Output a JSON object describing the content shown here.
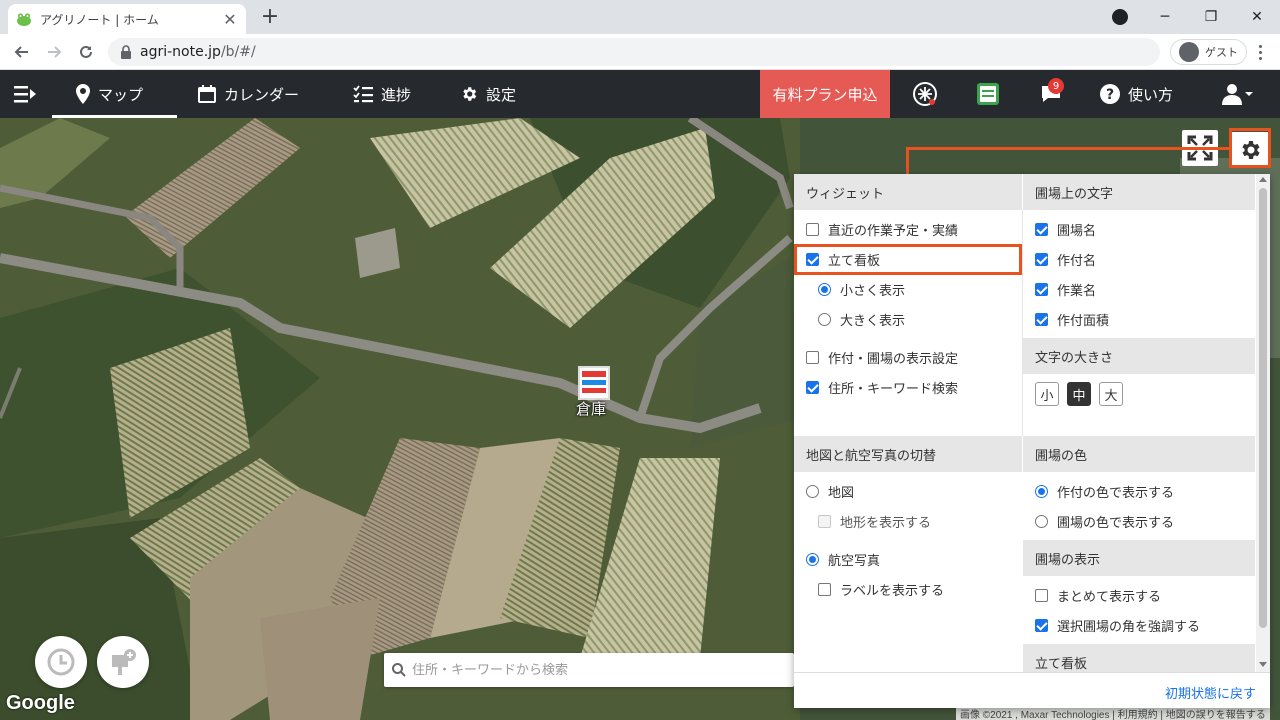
{
  "browser": {
    "tab_title": "アグリノート | ホーム",
    "url_host": "agri-note.jp",
    "url_path": "/b/#/",
    "profile_label": "ゲスト"
  },
  "navbar": {
    "map": "マップ",
    "calendar": "カレンダー",
    "progress": "進捗",
    "settings": "設定",
    "premium": "有料プラン申込",
    "notification_count": "9",
    "help": "使い方"
  },
  "map": {
    "warehouse_label": "倉庫",
    "search_placeholder": "住所・キーワードから検索",
    "google": "Google",
    "attribution": "画像 ©2021 , Maxar Technologies | 利用規約 | 地図の誤りを報告する"
  },
  "panel": {
    "widget": {
      "title": "ウィジェット",
      "items": [
        {
          "label": "直近の作業予定・実績",
          "checked": false
        },
        {
          "label": "立て看板",
          "checked": true
        },
        {
          "label": "小さく表示",
          "selected": true
        },
        {
          "label": "大きく表示",
          "selected": false
        },
        {
          "label": "作付・圃場の表示設定",
          "checked": false
        },
        {
          "label": "住所・キーワード検索",
          "checked": true
        }
      ]
    },
    "field_text": {
      "title": "圃場上の文字",
      "items": [
        {
          "label": "圃場名",
          "checked": true
        },
        {
          "label": "作付名",
          "checked": true
        },
        {
          "label": "作業名",
          "checked": true
        },
        {
          "label": "作付面積",
          "checked": true
        }
      ]
    },
    "text_size": {
      "title": "文字の大きさ",
      "options": [
        "小",
        "中",
        "大"
      ],
      "selected": "中"
    },
    "map_switch": {
      "title": "地図と航空写真の切替",
      "items": [
        {
          "label": "地図",
          "selected": false
        },
        {
          "label": "地形を表示する",
          "checked": false
        },
        {
          "label": "航空写真",
          "selected": true
        },
        {
          "label": "ラベルを表示する",
          "checked": false
        }
      ]
    },
    "field_color": {
      "title": "圃場の色",
      "items": [
        {
          "label": "作付の色で表示する",
          "selected": true
        },
        {
          "label": "圃場の色で表示する",
          "selected": false
        }
      ]
    },
    "field_display": {
      "title": "圃場の表示",
      "items": [
        {
          "label": "まとめて表示する",
          "checked": false
        },
        {
          "label": "選択圃場の角を強調する",
          "checked": true
        }
      ]
    },
    "billboard": {
      "title": "立て看板"
    },
    "reset": "初期状態に戻す"
  },
  "colors": {
    "navbar_bg": "#26292d",
    "premium_bg": "#e65a55",
    "highlight": "#e8521e",
    "accent": "#1a73e8"
  }
}
